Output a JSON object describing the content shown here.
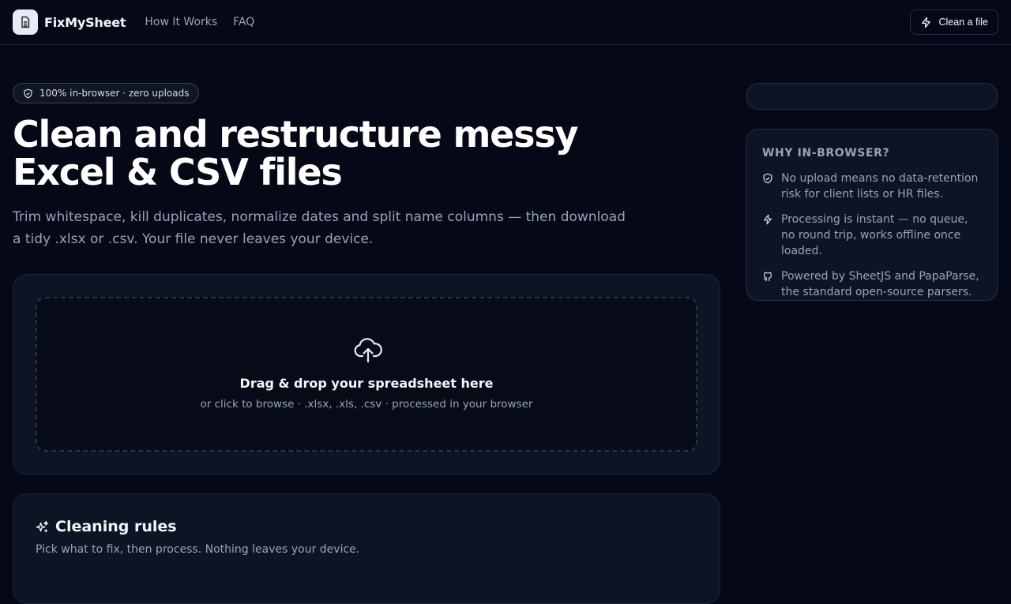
{
  "header": {
    "brand": "FixMySheet",
    "nav": [
      "How It Works",
      "FAQ"
    ],
    "cta_label": "Clean a file"
  },
  "hero": {
    "badge": "100% in-browser · zero uploads",
    "title_line1": "Clean and restructure messy",
    "title_line2": "Excel & CSV files",
    "subtitle": "Trim whitespace, kill duplicates, normalize dates and split name columns — then download a tidy .xlsx or .csv. Your file never leaves your device."
  },
  "dropzone": {
    "title": "Drag & drop your spreadsheet here",
    "subtitle": "or click to browse · .xlsx, .xls, .csv · processed in your browser"
  },
  "rules": {
    "title": "Cleaning rules",
    "subtitle": "Pick what to fix, then process. Nothing leaves your device."
  },
  "why": {
    "title": "WHY IN-BROWSER?",
    "items": [
      {
        "icon": "shield-check-icon",
        "text": "No upload means no data-retention risk for client lists or HR files."
      },
      {
        "icon": "lightning-icon",
        "text": "Processing is instant — no queue, no round trip, works offline once loaded."
      },
      {
        "icon": "github-icon",
        "text": "Powered by SheetJS and PapaParse, the standard open-source parsers."
      }
    ]
  },
  "colors": {
    "background": "#050816",
    "card": "#0e1424",
    "muted_text": "#9aa3b5",
    "text": "#f4f6fb"
  }
}
